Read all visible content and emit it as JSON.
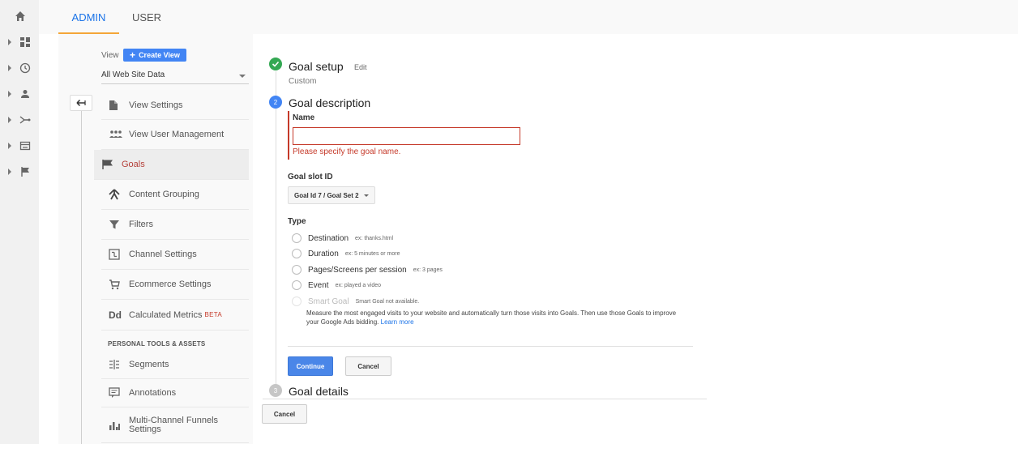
{
  "tabs": {
    "admin": "ADMIN",
    "user": "USER"
  },
  "rail": {
    "icons": [
      "home-icon",
      "dashboard-icon",
      "clock-icon",
      "person-icon",
      "acquisition-icon",
      "behavior-icon",
      "conversions-flag-icon"
    ]
  },
  "view_panel": {
    "view_label": "View",
    "create_view_label": "Create View",
    "selected_view": "All Web Site Data",
    "items": [
      {
        "label": "View Settings",
        "icon": "document-icon"
      },
      {
        "label": "View User Management",
        "icon": "users-icon"
      },
      {
        "label": "Goals",
        "icon": "flag-icon",
        "active": true
      },
      {
        "label": "Content Grouping",
        "icon": "content-grouping-icon"
      },
      {
        "label": "Filters",
        "icon": "filter-icon"
      },
      {
        "label": "Channel Settings",
        "icon": "channel-settings-icon"
      },
      {
        "label": "Ecommerce Settings",
        "icon": "cart-icon"
      },
      {
        "label": "Calculated Metrics",
        "badge": "BETA",
        "icon": "calculated-metrics-icon"
      }
    ],
    "personal_section": "PERSONAL TOOLS & ASSETS",
    "personal_items": [
      {
        "label": "Segments",
        "icon": "segments-icon"
      },
      {
        "label": "Annotations",
        "icon": "annotations-icon"
      },
      {
        "label_line1": "Multi-Channel Funnels",
        "label_line2": "Settings",
        "icon": "bar-chart-icon"
      }
    ]
  },
  "goal": {
    "setup": {
      "title": "Goal setup",
      "edit": "Edit",
      "value": "Custom"
    },
    "description": {
      "step_number": "2",
      "title": "Goal description",
      "name_label": "Name",
      "name_value": "",
      "name_error": "Please specify the goal name.",
      "slot_label": "Goal slot ID",
      "slot_value": "Goal Id 7 / Goal Set 2",
      "type_label": "Type",
      "types": [
        {
          "label": "Destination",
          "example": "ex: thanks.html"
        },
        {
          "label": "Duration",
          "example": "ex: 5 minutes or more"
        },
        {
          "label": "Pages/Screens per session",
          "example": "ex: 3 pages"
        },
        {
          "label": "Event",
          "example": "ex: played a video"
        },
        {
          "label": "Smart Goal",
          "example": "Smart Goal not available.",
          "disabled": true
        }
      ],
      "smart_goal_desc": "Measure the most engaged visits to your website and automatically turn those visits into Goals. Then use those Goals to improve your Google Ads bidding.",
      "learn_more": "Learn more",
      "continue_label": "Continue",
      "cancel_label": "Cancel"
    },
    "details": {
      "step_number": "3",
      "title": "Goal details"
    },
    "bottom_cancel_label": "Cancel"
  },
  "colors": {
    "accent": "#4285f4",
    "error": "#c53929",
    "success": "#34a853",
    "tab_underline": "#f4a638"
  }
}
